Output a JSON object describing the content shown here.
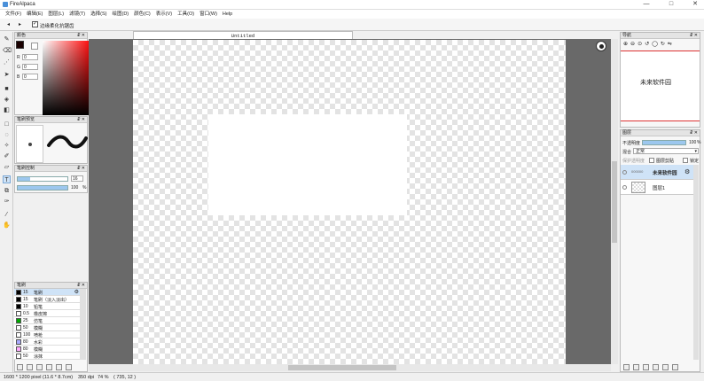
{
  "window": {
    "title": "FireAlpaca",
    "min": "—",
    "max": "□",
    "close": "✕"
  },
  "menu": [
    "文件(F)",
    "编辑(E)",
    "图层(L)",
    "滤镜(T)",
    "选择(S)",
    "绘图(D)",
    "颜色(C)",
    "表示(V)",
    "工具(O)",
    "窗口(W)",
    "Help"
  ],
  "toolbar": {
    "undo": "◂",
    "redo": "▸",
    "aa_label": "边缘柔化抗锯齿",
    "aa_checked": true
  },
  "color_panel": {
    "title": "颜色",
    "r_label": "R",
    "g_label": "G",
    "b_label": "B",
    "r": "0",
    "g": "0",
    "b": "0",
    "fg": "#1a0000",
    "bg": "#ffffff"
  },
  "brush_shape": {
    "title": "笔刷预览"
  },
  "brush_ctrl": {
    "title": "笔刷控制",
    "size": "16",
    "opacity": "100",
    "opacity_unit": "%",
    "size_fill": 0.25,
    "opacity_fill": 1.0
  },
  "brush_list": {
    "title": "笔刷",
    "items": [
      {
        "size": "15",
        "name": "笔刷",
        "color": "#000000",
        "selected": true
      },
      {
        "size": "15",
        "name": "笔刷（淡入淡出）",
        "color": "#000000"
      },
      {
        "size": "10",
        "name": "铅笔",
        "color": "#000000"
      },
      {
        "size": "0.5",
        "name": "橡皮擦",
        "color": "#ffffff"
      },
      {
        "size": "25",
        "name": "仿笔",
        "color": "#00aa00"
      },
      {
        "size": "50",
        "name": "模糊",
        "color": "#ffffff"
      },
      {
        "size": "100",
        "name": "喷枪",
        "color": "#ffffff"
      },
      {
        "size": "80",
        "name": "水彩",
        "color": "#aaaaff"
      },
      {
        "size": "80",
        "name": "模糊",
        "color": "#ffaaff"
      },
      {
        "size": "50",
        "name": "涂抹",
        "color": "#ffffff"
      }
    ]
  },
  "document": {
    "tab": "Untitled"
  },
  "navigator": {
    "title": "导航",
    "preview_text": "未来软件园"
  },
  "layer_panel": {
    "title": "图层",
    "opacity_label": "不透明度",
    "opacity": "100",
    "opacity_unit": "%",
    "opacity_fill": 1.0,
    "blend_label": "混合",
    "blend": "正常",
    "protect": "保护透明度",
    "clip": "图层剪贴",
    "lock": "锁定",
    "layers": [
      {
        "name": "未来软件园",
        "selected": true,
        "tag": "000000"
      },
      {
        "name": "图层1",
        "selected": false
      }
    ]
  },
  "status": {
    "size": "1600 * 1200 pixel",
    "cm": "(11.6 * 8.7cm)",
    "dpi": "350 dpi",
    "zoom": "74 %",
    "coord": "( 735, 12 )"
  }
}
